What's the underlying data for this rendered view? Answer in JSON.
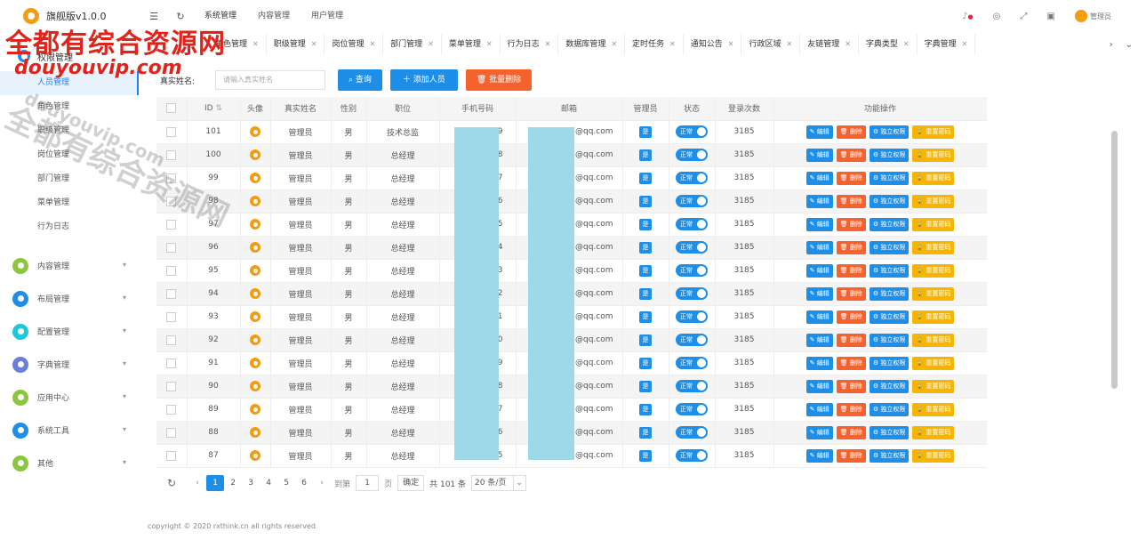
{
  "app": {
    "title": "旗舰版v1.0.0"
  },
  "topnav": {
    "tabs": [
      {
        "label": "系统管理",
        "active": true
      },
      {
        "label": "内容管理",
        "active": false
      },
      {
        "label": "用户管理",
        "active": false
      }
    ],
    "user_label": "管理员"
  },
  "sidebar": {
    "group_label": "权限管理",
    "sub_items": [
      {
        "label": "人员管理",
        "active": true
      },
      {
        "label": "角色管理",
        "active": false
      },
      {
        "label": "职级管理",
        "active": false
      },
      {
        "label": "岗位管理",
        "active": false
      },
      {
        "label": "部门管理",
        "active": false
      },
      {
        "label": "菜单管理",
        "active": false
      },
      {
        "label": "行为日志",
        "active": false
      }
    ],
    "categories": [
      {
        "label": "内容管理",
        "color": "#8cc63f"
      },
      {
        "label": "布局管理",
        "color": "#1e8fe9"
      },
      {
        "label": "配置管理",
        "color": "#1ec8d8"
      },
      {
        "label": "字典管理",
        "color": "#6a7fdb"
      },
      {
        "label": "应用中心",
        "color": "#8cc63f"
      },
      {
        "label": "系统工具",
        "color": "#1e8fe9"
      },
      {
        "label": "其他",
        "color": "#8cc63f"
      }
    ]
  },
  "page_tabs": [
    "人员管理",
    "角色管理",
    "职级管理",
    "岗位管理",
    "部门管理",
    "菜单管理",
    "行为日志",
    "数据库管理",
    "定时任务",
    "通知公告",
    "行政区域",
    "友链管理",
    "字典类型",
    "字典管理"
  ],
  "search": {
    "label": "真实姓名:",
    "placeholder": "请输入真实姓名",
    "query_button": "查询",
    "add_button": "添加人员",
    "batch_delete_button": "批量删除"
  },
  "table": {
    "headers": [
      "",
      "ID",
      "头像",
      "真实姓名",
      "性别",
      "职位",
      "手机号码",
      "邮箱",
      "管理员",
      "状态",
      "登录次数",
      "功能操作"
    ],
    "admin_label": "是",
    "status_label": "正常",
    "actions": [
      "编辑",
      "删除",
      "独立权限",
      "重置密码"
    ],
    "rows": [
      {
        "id": "101",
        "name": "管理员",
        "gender": "男",
        "position": "技术总监",
        "phone_tail": "9",
        "email_tail": "@qq.com",
        "logins": "3185"
      },
      {
        "id": "100",
        "name": "管理员",
        "gender": "男",
        "position": "总经理",
        "phone_tail": "8",
        "email_tail": "@qq.com",
        "logins": "3185"
      },
      {
        "id": "99",
        "name": "管理员",
        "gender": "男",
        "position": "总经理",
        "phone_tail": "7",
        "email_tail": "@qq.com",
        "logins": "3185"
      },
      {
        "id": "98",
        "name": "管理员",
        "gender": "男",
        "position": "总经理",
        "phone_tail": "6",
        "email_tail": "@qq.com",
        "logins": "3185"
      },
      {
        "id": "97",
        "name": "管理员",
        "gender": "男",
        "position": "总经理",
        "phone_tail": "5",
        "email_tail": "@qq.com",
        "logins": "3185"
      },
      {
        "id": "96",
        "name": "管理员",
        "gender": "男",
        "position": "总经理",
        "phone_tail": "4",
        "email_tail": "@qq.com",
        "logins": "3185"
      },
      {
        "id": "95",
        "name": "管理员",
        "gender": "男",
        "position": "总经理",
        "phone_tail": "3",
        "email_tail": "@qq.com",
        "logins": "3185"
      },
      {
        "id": "94",
        "name": "管理员",
        "gender": "男",
        "position": "总经理",
        "phone_tail": "2",
        "email_tail": "@qq.com",
        "logins": "3185"
      },
      {
        "id": "93",
        "name": "管理员",
        "gender": "男",
        "position": "总经理",
        "phone_tail": "1",
        "email_tail": "@qq.com",
        "logins": "3185"
      },
      {
        "id": "92",
        "name": "管理员",
        "gender": "男",
        "position": "总经理",
        "phone_tail": "0",
        "email_tail": "@qq.com",
        "logins": "3185"
      },
      {
        "id": "91",
        "name": "管理员",
        "gender": "男",
        "position": "总经理",
        "phone_tail": "9",
        "email_tail": "@qq.com",
        "logins": "3185"
      },
      {
        "id": "90",
        "name": "管理员",
        "gender": "男",
        "position": "总经理",
        "phone_tail": "8",
        "email_tail": "@qq.com",
        "logins": "3185"
      },
      {
        "id": "89",
        "name": "管理员",
        "gender": "男",
        "position": "总经理",
        "phone_tail": "7",
        "email_tail": "@qq.com",
        "logins": "3185"
      },
      {
        "id": "88",
        "name": "管理员",
        "gender": "男",
        "position": "总经理",
        "phone_tail": "6",
        "email_tail": "@qq.com",
        "logins": "3185"
      },
      {
        "id": "87",
        "name": "管理员",
        "gender": "男",
        "position": "总经理",
        "phone_tail": "5",
        "email_tail": "@qq.com",
        "logins": "3185"
      }
    ]
  },
  "pagination": {
    "pages": [
      "1",
      "2",
      "3",
      "4",
      "5",
      "6"
    ],
    "current": "1",
    "goto_label": "到第",
    "goto_value": "1",
    "page_unit": "页",
    "confirm": "确定",
    "total": "共 101 条",
    "page_size": "20 条/页"
  },
  "footer": "copyright © 2020 rxthink.cn all rights reserved",
  "watermark": {
    "line1": "全都有综合资源网",
    "line2": "douyouvip.com",
    "line3": "全都有综合资源网",
    "line4": "douyouvip.com"
  },
  "colors": {
    "primary": "#1e8fe9",
    "danger": "#f5622d",
    "warning": "#f7b500",
    "brand": "#f39c12"
  }
}
